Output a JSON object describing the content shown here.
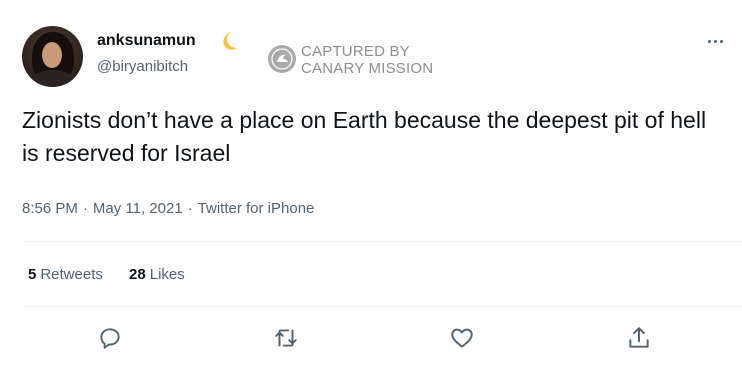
{
  "tweet": {
    "display_name": "anksunamun",
    "name_emoji": "crescent-moon-icon",
    "handle": "@biryanibitch",
    "text": "Zionists don’t have a place on Earth because the deepest pit of hell is reserved for Israel",
    "time": "8:56 PM",
    "date": "May 11, 2021",
    "source": "Twitter for iPhone",
    "separator": "·"
  },
  "watermark": {
    "line1": "CAPTURED BY",
    "line2": "CANARY MISSION"
  },
  "stats": {
    "retweets_count": "5",
    "retweets_label": "Retweets",
    "likes_count": "28",
    "likes_label": "Likes"
  },
  "actions": [
    "reply-icon",
    "retweet-icon",
    "like-icon",
    "share-icon"
  ],
  "colors": {
    "text": "#0f1419",
    "secondary": "#536471",
    "divider": "#eff3f4",
    "watermark": "#8c8e91",
    "moon": "#f5c542"
  }
}
